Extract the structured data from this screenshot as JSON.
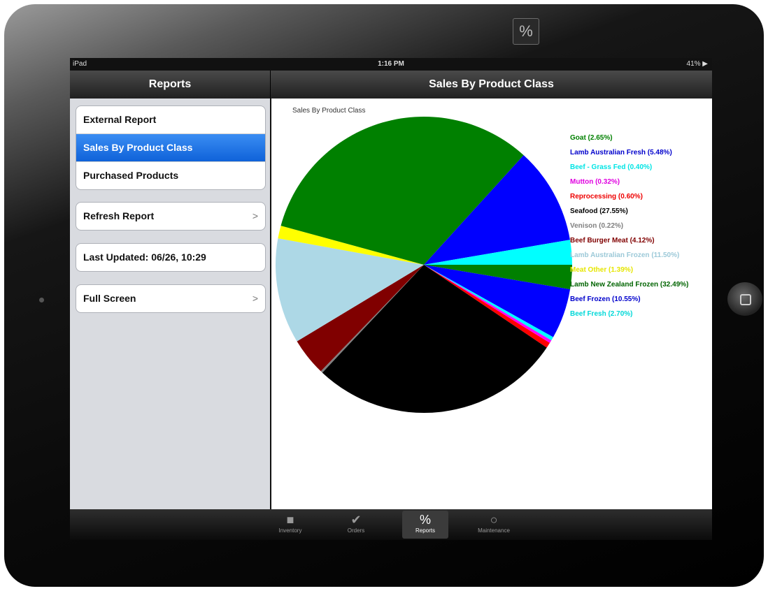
{
  "status": {
    "device": "iPad",
    "time": "1:16 PM",
    "battery": "41% ▶"
  },
  "master": {
    "title": "Reports"
  },
  "detail": {
    "title": "Sales By Product Class"
  },
  "menu": {
    "reports": [
      "External Report",
      "Sales By Product Class",
      "Purchased Products"
    ],
    "refresh": "Refresh Report",
    "last_updated": "Last Updated: 06/26, 10:29",
    "full_screen": "Full Screen",
    "chevron": ">"
  },
  "device": {
    "top_icon": "%"
  },
  "tabs": [
    {
      "label": "Inventory",
      "icon": "inventory-icon",
      "glyph": "■"
    },
    {
      "label": "Orders",
      "icon": "checkmark-icon",
      "glyph": "✔"
    },
    {
      "label": "Reports",
      "icon": "percent-icon",
      "glyph": "%"
    },
    {
      "label": "Maintenance",
      "icon": "gear-icon",
      "glyph": "○"
    }
  ],
  "chart_data": {
    "type": "pie",
    "title": "Sales By Product Class",
    "legend_position": "right",
    "series": [
      {
        "name": "Goat",
        "value": 2.65,
        "color": "#008000",
        "label": "Goat (2.65%)"
      },
      {
        "name": "Lamb Australian Fresh",
        "value": 5.48,
        "color": "#0000ff",
        "label": "Lamb Australian Fresh (5.48%)"
      },
      {
        "name": "Beef - Grass Fed",
        "value": 0.4,
        "color": "#00ffff",
        "label": "Beef - Grass Fed (0.40%)"
      },
      {
        "name": "Mutton",
        "value": 0.32,
        "color": "#ff00ff",
        "label": "Mutton (0.32%)"
      },
      {
        "name": "Reprocessing",
        "value": 0.6,
        "color": "#ff0000",
        "label": "Reprocessing (0.60%)"
      },
      {
        "name": "Seafood",
        "value": 27.55,
        "color": "#000000",
        "label": "Seafood (27.55%)"
      },
      {
        "name": "Venison",
        "value": 0.22,
        "color": "#808080",
        "label": "Venison (0.22%)"
      },
      {
        "name": "Beef Burger Meat",
        "value": 4.12,
        "color": "#800000",
        "label": "Beef Burger Meat (4.12%)"
      },
      {
        "name": "Lamb Australian Frozen",
        "value": 11.5,
        "color": "#add8e6",
        "label": "Lamb Australian Frozen (11.50%)"
      },
      {
        "name": "Meat Other",
        "value": 1.39,
        "color": "#ffff00",
        "label": "Meat Other (1.39%)"
      },
      {
        "name": "Lamb New Zealand Frozen",
        "value": 32.49,
        "color": "#008000",
        "label": "Lamb New Zealand Frozen (32.49%)"
      },
      {
        "name": "Beef Frozen",
        "value": 10.55,
        "color": "#0000ff",
        "label": "Beef Frozen (10.55%)"
      },
      {
        "name": "Beef Fresh",
        "value": 2.7,
        "color": "#00ffff",
        "label": "Beef Fresh (2.70%)"
      }
    ]
  }
}
